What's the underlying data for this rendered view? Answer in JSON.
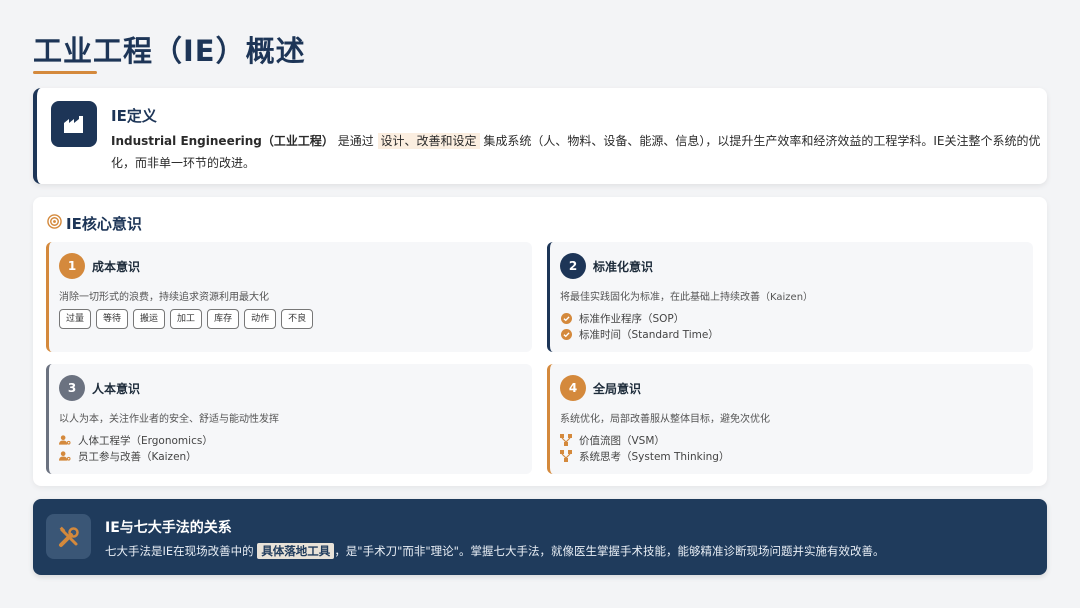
{
  "header": {
    "title": "工业工程（IE）概述"
  },
  "definition": {
    "icon": "factory-icon",
    "title": "IE定义",
    "term": "Industrial Engineering（工业工程）",
    "text_before": " 是通过 ",
    "highlight": "设计、改善和设定",
    "text_after": " 集成系统（人、物料、设备、能源、信息），以提升生产效率和经济效益的工程学科。IE关注整个系统的优化，而非单一环节的改进。"
  },
  "core": {
    "icon": "target-icon",
    "title": "IE核心意识",
    "quadrants": [
      {
        "num": "1",
        "title": "成本意识",
        "desc": "消除一切形式的浪费，持续追求资源利用最大化",
        "tags": [
          "过量",
          "等待",
          "搬运",
          "加工",
          "库存",
          "动作",
          "不良"
        ]
      },
      {
        "num": "2",
        "title": "标准化意识",
        "desc": "将最佳实践固化为标准，在此基础上持续改善（Kaizen）",
        "items": [
          "标准作业程序（SOP）",
          "标准时间（Standard Time）"
        ]
      },
      {
        "num": "3",
        "title": "人本意识",
        "desc": "以人为本，关注作业者的安全、舒适与能动性发挥",
        "items": [
          "人体工程学（Ergonomics）",
          "员工参与改善（Kaizen）"
        ]
      },
      {
        "num": "4",
        "title": "全局意识",
        "desc": "系统优化，局部改善服从整体目标，避免次优化",
        "items": [
          "价值流图（VSM）",
          "系统思考（System Thinking）"
        ]
      }
    ]
  },
  "banner": {
    "icon": "tools-icon",
    "title": "IE与七大手法的关系",
    "text_before": "七大手法是IE在现场改善中的 ",
    "highlight": "具体落地工具",
    "text_after": "，是\"手术刀\"而非\"理论\"。掌握七大手法，就像医生掌握手术技能，能够精准诊断现场问题并实施有效改善。"
  },
  "colors": {
    "navy": "#1d3557",
    "orange": "#d4893c",
    "gray": "#6b7280",
    "banner": "#1f3b5c"
  }
}
